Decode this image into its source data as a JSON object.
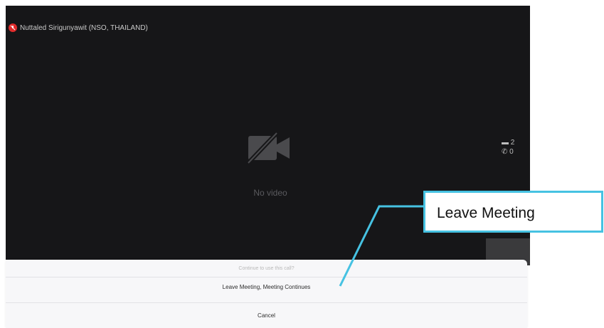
{
  "video": {
    "speaker_name": "Nuttaled Sirigunyawit (NSO, THAILAND)",
    "no_video_label": "No video",
    "participant_count": "2",
    "phone_count": "0"
  },
  "action_sheet": {
    "prompt": "Continue to use this call?",
    "leave_option": "Leave Meeting, Meeting Continues",
    "cancel_option": "Cancel"
  },
  "annotation": {
    "callout_text": "Leave Meeting",
    "color": "#46c2e2"
  },
  "colors": {
    "video_bg": "#161618",
    "mute_red": "#e02b2b",
    "sheet_bg": "#f7f7f9"
  },
  "icons": [
    "mic-muted-icon",
    "camera-off-icon",
    "participants-icon",
    "phone-icon"
  ]
}
